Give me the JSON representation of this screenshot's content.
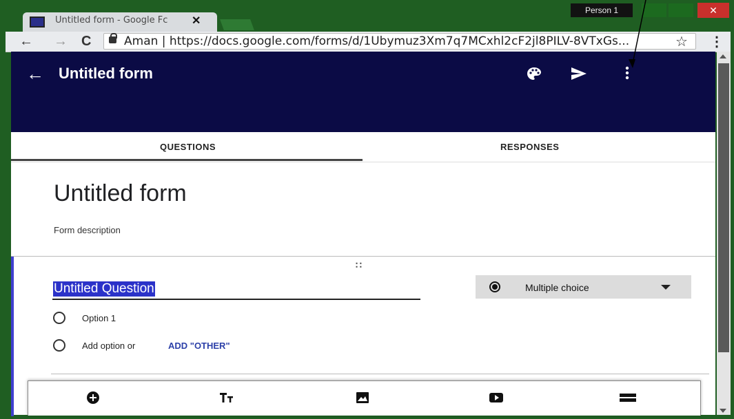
{
  "browser": {
    "tab_title": "Untitled form - Google Fc",
    "tab_close": "✕",
    "profile": "Person 1",
    "close_glyph": "✕",
    "back": "←",
    "forward": "→",
    "reload": "C",
    "url": "Aman | https://docs.google.com/forms/d/1Ubymuz3Xm7q7MCxhl2cF2jl8PILV-8VTxGs...",
    "star": "☆",
    "menu": "⋮"
  },
  "header": {
    "back_icon": "←",
    "title": "Untitled form",
    "icons": [
      "palette-icon",
      "send-icon",
      "more-vert-icon"
    ]
  },
  "tabs": {
    "questions": "QUESTIONS",
    "responses": "RESPONSES"
  },
  "form": {
    "title": "Untitled form",
    "description": "Form description"
  },
  "question": {
    "drag_handle": "∷",
    "title": "Untitled Question",
    "type": "Multiple choice",
    "option1": "Option 1",
    "add_option": "Add option  or",
    "add_other": "ADD \"OTHER\""
  },
  "bottom_toolbar": {
    "icons": [
      "add-question-icon",
      "title-text-icon",
      "image-icon",
      "video-icon",
      "section-icon"
    ]
  },
  "colors": {
    "header_bg": "#0b0b45",
    "window_frame": "#1f5e22",
    "selection": "#2b32c9",
    "accent_bar": "#3f3fcf"
  }
}
